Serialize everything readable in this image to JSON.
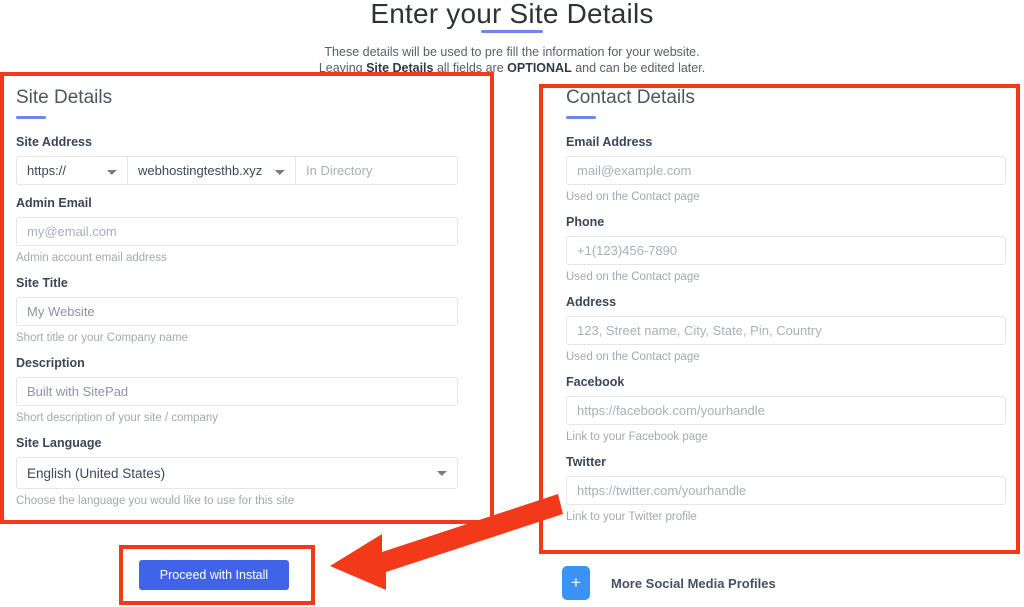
{
  "header": {
    "title": "Enter your Site Details",
    "subtitle_line1": "These details will be used to pre fill the information for your website.",
    "subtitle_line2_a": "Leaving ",
    "subtitle_line2_b": "Site Details",
    "subtitle_line2_c": " all fields are ",
    "subtitle_line2_d": "OPTIONAL",
    "subtitle_line2_e": " and can be edited later."
  },
  "site_details": {
    "section_title": "Site Details",
    "site_address": {
      "label": "Site Address",
      "protocol_value": "https://",
      "domain_value": "webhostingtesthb.xyz",
      "directory_placeholder": "In Directory",
      "directory_value": ""
    },
    "admin_email": {
      "label": "Admin Email",
      "placeholder": "my@email.com",
      "value": "",
      "help": "Admin account email address"
    },
    "site_title": {
      "label": "Site Title",
      "value": "My Website",
      "placeholder": "My Website",
      "help": "Short title or your Company name"
    },
    "description": {
      "label": "Description",
      "value": "Built with SitePad",
      "placeholder": "Built with SitePad",
      "help": "Short description of your site / company"
    },
    "site_language": {
      "label": "Site Language",
      "value": "English (United States)",
      "help": "Choose the language you would like to use for this site"
    }
  },
  "contact_details": {
    "section_title": "Contact Details",
    "email": {
      "label": "Email Address",
      "placeholder": "mail@example.com",
      "value": "",
      "help": "Used on the Contact page"
    },
    "phone": {
      "label": "Phone",
      "placeholder": "+1(123)456-7890",
      "value": "",
      "help": "Used on the Contact page"
    },
    "address": {
      "label": "Address",
      "placeholder": "123, Street name, City, State, Pin, Country",
      "value": "",
      "help": "Used on the Contact page"
    },
    "facebook": {
      "label": "Facebook",
      "placeholder": "https://facebook.com/yourhandle",
      "value": "",
      "help": "Link to your Facebook page"
    },
    "twitter": {
      "label": "Twitter",
      "placeholder": "https://twitter.com/yourhandle",
      "value": "",
      "help": "Link to your Twitter profile"
    }
  },
  "footer": {
    "proceed_label": "Proceed with Install",
    "more_social_label": "More Social Media Profiles",
    "plus_glyph": "+"
  },
  "colors": {
    "accent_rule": "#6c87ea",
    "primary_button": "#4163e9",
    "plus_button": "#3d93f5",
    "annotation_red": "#f23a1a",
    "label_text": "#3b4656",
    "help_text": "#a2a9b0"
  }
}
